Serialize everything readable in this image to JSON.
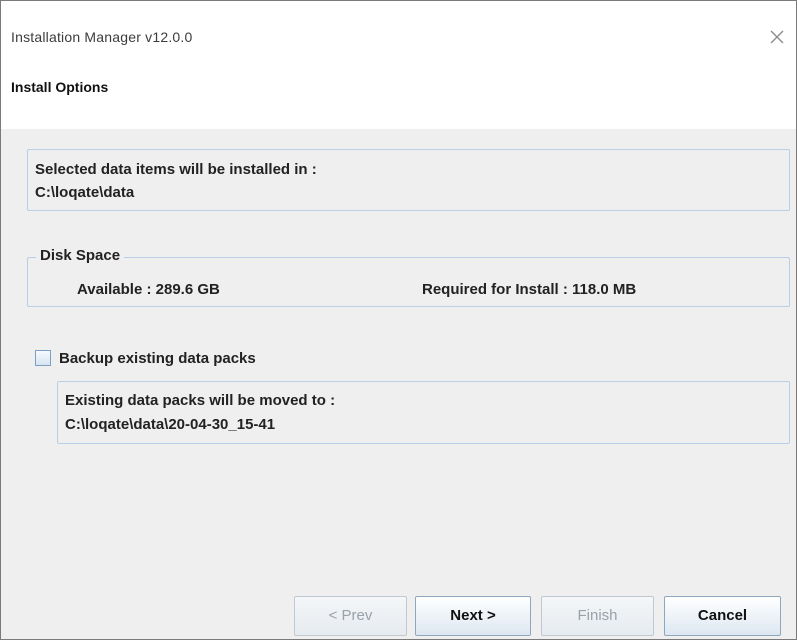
{
  "window": {
    "title": "Installation Manager v12.0.0"
  },
  "header": {
    "title": "Install Options"
  },
  "install_location": {
    "label": "Selected data items will be installed in :",
    "path": "C:\\loqate\\data"
  },
  "disk_space": {
    "legend": "Disk Space",
    "available": "Available : 289.6 GB",
    "required": "Required for Install : 118.0 MB"
  },
  "backup": {
    "checkbox_label": "Backup existing data packs",
    "checked": false,
    "moved_label": "Existing data packs will be moved to :",
    "moved_path": "C:\\loqate\\data\\20-04-30_15-41"
  },
  "buttons": {
    "prev": "< Prev",
    "next": "Next >",
    "finish": "Finish",
    "cancel": "Cancel"
  }
}
